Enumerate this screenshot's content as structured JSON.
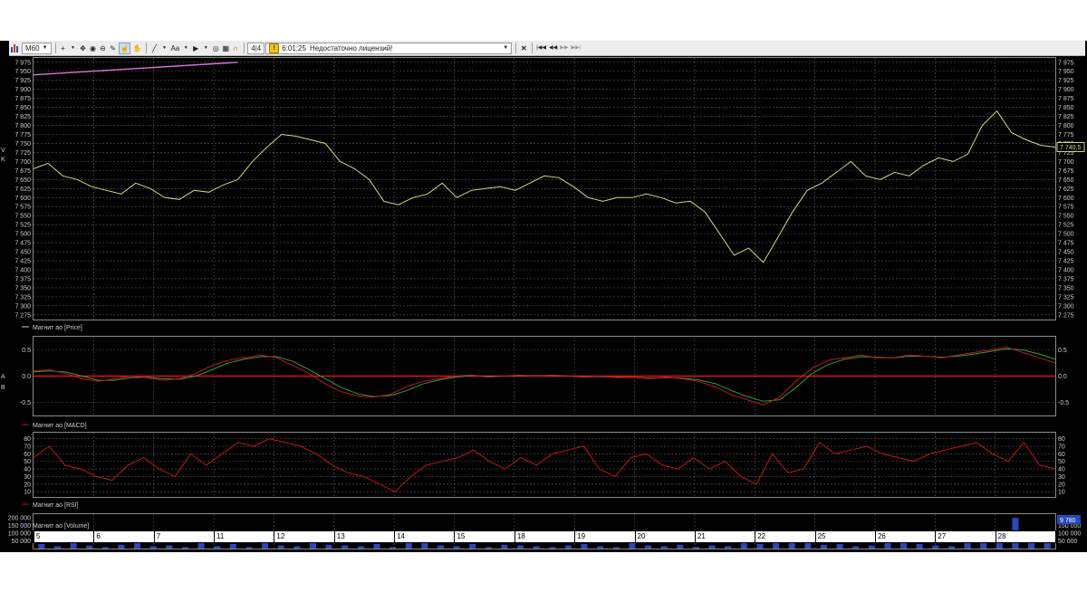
{
  "toolbar": {
    "chart_icon": "bar-chart-icon",
    "timeframe": "M60",
    "crosshair_icon": "plus",
    "move_icon": "move-arrows",
    "zoom_icon": "circle-target",
    "ruler_icon": "pencil",
    "hand_icon": "hand",
    "line_tool": "line",
    "text_tool": "Aa",
    "marker_icon": "marker-arrow",
    "page": "4|4",
    "message_time": "6:01:25",
    "message_text": "Недостаточно лицензий!",
    "close_icon": "x",
    "nav_first": "|◀◀",
    "nav_prev": "◀◀",
    "nav_next": "▶▶",
    "nav_last": "▶▶|"
  },
  "side_fragments": [
    "V",
    "K",
    "A",
    "B"
  ],
  "price_panel": {
    "legend": "Магнит ао [Price]",
    "line_color": "#d8d87a",
    "current_label": "7 740,5"
  },
  "macd_panel": {
    "legend": "Магнит ао [MACD]",
    "macd_color": "#c0181b",
    "signal_color": "#2e9d3a",
    "zero_line_color": "#e01010"
  },
  "rsi_panel": {
    "legend": "Магнит ао [RSI]",
    "line_color": "#c0181b"
  },
  "volume_panel": {
    "legend": "Магнит ао [Volume]",
    "bar_color": "#2a48b8",
    "current_label": "9 780"
  },
  "x_axis_labels": [
    "5",
    "6",
    "7",
    "11",
    "12",
    "13",
    "14",
    "15",
    "18",
    "19",
    "20",
    "21",
    "22",
    "25",
    "26",
    "27",
    "28"
  ],
  "chart_data": [
    {
      "type": "line",
      "panel": "price",
      "x_categories": [
        "5",
        "6",
        "7",
        "11",
        "12",
        "13",
        "14",
        "15",
        "18",
        "19",
        "20",
        "21",
        "22",
        "25",
        "26",
        "27",
        "28"
      ],
      "y_tick_labels": [
        "7 975",
        "7 950",
        "7 925",
        "7 900",
        "7 875",
        "7 850",
        "7 825",
        "7 800",
        "7 775",
        "7 750",
        "7 725",
        "7 700",
        "7 675",
        "7 650",
        "7 625",
        "7 600",
        "7 575",
        "7 550",
        "7 525",
        "7 500",
        "7 475",
        "7 450",
        "7 425",
        "7 400",
        "7 375",
        "7 350",
        "7 325",
        "7 300",
        "7 275"
      ],
      "ylim": [
        7262,
        7987
      ],
      "series": [
        {
          "values": [
            7680,
            7695,
            7660,
            7650,
            7630,
            7620,
            7610,
            7640,
            7625,
            7600,
            7595,
            7620,
            7615,
            7635,
            7650,
            7700,
            7740,
            7775,
            7770,
            7760,
            7750,
            7700,
            7680,
            7650,
            7590,
            7580,
            7600,
            7610,
            7640,
            7600,
            7620,
            7625,
            7630,
            7620,
            7640,
            7660,
            7655,
            7630,
            7600,
            7590,
            7600,
            7600,
            7610,
            7600,
            7585,
            7590,
            7560,
            7500,
            7440,
            7460,
            7420,
            7490,
            7560,
            7620,
            7640,
            7670,
            7700,
            7660,
            7650,
            7670,
            7660,
            7690,
            7710,
            7700,
            7720,
            7800,
            7840,
            7780,
            7760,
            7745,
            7740
          ]
        }
      ],
      "overlay_line": {
        "color": "#e070e0",
        "values": [
          7940,
          7975
        ]
      }
    },
    {
      "type": "line",
      "panel": "macd",
      "y_tick_labels": [
        "0.5",
        "0.0",
        "-0.5"
      ],
      "ylim": [
        -0.75,
        0.75
      ],
      "series": [
        {
          "values": [
            0.1,
            0.12,
            0.05,
            -0.05,
            -0.1,
            -0.05,
            0,
            -0.03,
            -0.08,
            -0.05,
            0.05,
            0.2,
            0.3,
            0.35,
            0.4,
            0.35,
            0.2,
            0.05,
            -0.15,
            -0.3,
            -0.38,
            -0.4,
            -0.35,
            -0.2,
            -0.1,
            -0.05,
            0,
            0.02,
            -0.02,
            0,
            0.02,
            0,
            0.02,
            0,
            -0.02,
            0,
            -0.03,
            -0.02,
            -0.05,
            -0.02,
            -0.05,
            -0.1,
            -0.2,
            -0.35,
            -0.45,
            -0.55,
            -0.4,
            -0.1,
            0.15,
            0.3,
            0.35,
            0.4,
            0.35,
            0.35,
            0.4,
            0.38,
            0.35,
            0.4,
            0.45,
            0.5,
            0.55,
            0.45,
            0.35,
            0.25
          ]
        },
        {
          "values": [
            0.08,
            0.1,
            0.08,
            0,
            -0.08,
            -0.08,
            -0.03,
            -0.02,
            -0.05,
            -0.06,
            0,
            0.12,
            0.25,
            0.32,
            0.37,
            0.37,
            0.28,
            0.12,
            -0.05,
            -0.22,
            -0.34,
            -0.39,
            -0.37,
            -0.28,
            -0.15,
            -0.07,
            -0.02,
            0.01,
            0,
            0,
            0.01,
            0.01,
            0.01,
            0,
            -0.01,
            -0.01,
            -0.02,
            -0.02,
            -0.04,
            -0.03,
            -0.04,
            -0.07,
            -0.14,
            -0.27,
            -0.39,
            -0.48,
            -0.45,
            -0.22,
            0.05,
            0.22,
            0.32,
            0.37,
            0.36,
            0.35,
            0.38,
            0.38,
            0.36,
            0.38,
            0.42,
            0.47,
            0.52,
            0.5,
            0.42,
            0.32
          ]
        }
      ]
    },
    {
      "type": "line",
      "panel": "rsi",
      "y_tick_labels": [
        "80",
        "70",
        "60",
        "50",
        "40",
        "30",
        "20",
        "10"
      ],
      "ylim": [
        3,
        88
      ],
      "series": [
        {
          "values": [
            55,
            70,
            45,
            40,
            30,
            25,
            45,
            55,
            40,
            30,
            60,
            45,
            60,
            75,
            70,
            80,
            75,
            70,
            60,
            45,
            35,
            30,
            20,
            10,
            30,
            45,
            50,
            55,
            65,
            50,
            40,
            55,
            45,
            60,
            65,
            70,
            40,
            30,
            55,
            60,
            45,
            40,
            55,
            40,
            50,
            30,
            20,
            60,
            35,
            40,
            75,
            60,
            65,
            70,
            60,
            55,
            50,
            60,
            65,
            70,
            75,
            60,
            50,
            75,
            45,
            40
          ]
        }
      ]
    },
    {
      "type": "bar",
      "panel": "volume",
      "y_tick_labels": [
        "200 000",
        "150 000",
        "100 000",
        "50 000"
      ],
      "ylim": [
        0,
        225000
      ],
      "values": [
        30000,
        15000,
        45000,
        20000,
        10000,
        25000,
        60000,
        15000,
        20000,
        10000,
        40000,
        15000,
        30000,
        10000,
        50000,
        20000,
        15000,
        40000,
        25000,
        20000,
        15000,
        30000,
        10000,
        45000,
        65000,
        20000,
        15000,
        30000,
        10000,
        25000,
        20000,
        15000,
        10000,
        20000,
        30000,
        15000,
        10000,
        50000,
        20000,
        15000,
        25000,
        10000,
        20000,
        15000,
        35000,
        30000,
        60000,
        90000,
        40000,
        25000,
        30000,
        15000,
        20000,
        40000,
        50000,
        30000,
        20000,
        15000,
        35000,
        70000,
        40000,
        200000,
        60000,
        40000
      ]
    }
  ]
}
